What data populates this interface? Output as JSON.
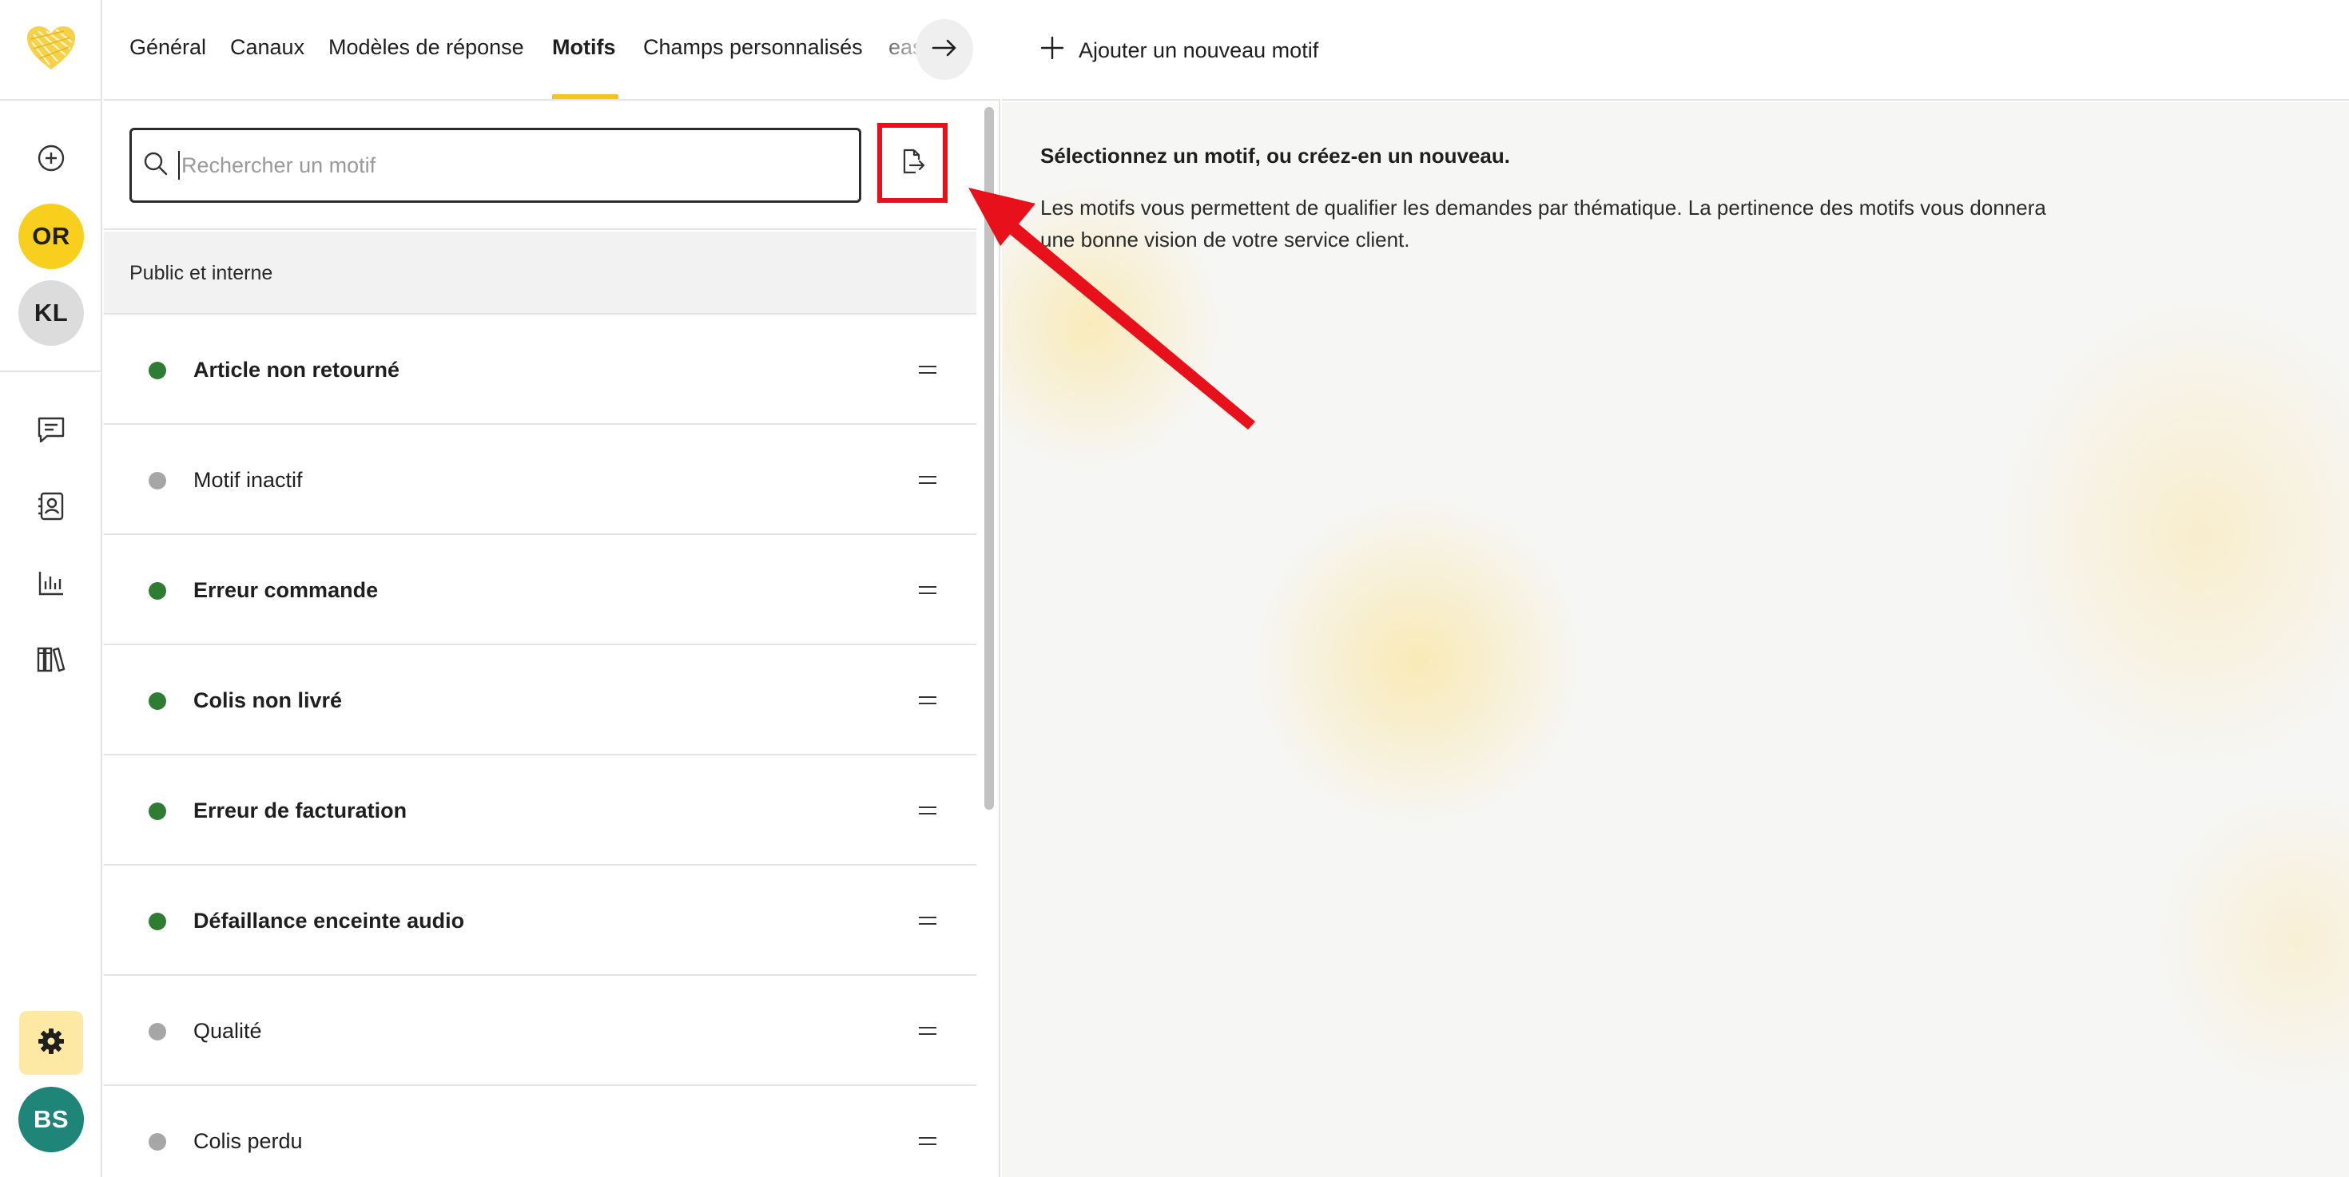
{
  "rail": {
    "logo_icon": "heart-logo",
    "add_icon": "plus-circle-icon",
    "avatars": [
      {
        "initials": "OR",
        "color": "#f9cf1d",
        "text_color": "#1f1f1f"
      },
      {
        "initials": "KL",
        "color": "#dcdcdc",
        "text_color": "#1f1f1f"
      }
    ],
    "nav_icons": [
      "chat-icon",
      "contacts-icon",
      "stats-icon",
      "library-icon"
    ],
    "settings_icon": "gear-icon",
    "user_avatar": {
      "initials": "BS",
      "color": "#1e8578",
      "text_color": "#ffffff"
    }
  },
  "tabs": {
    "items": [
      {
        "label": "Général",
        "active": false
      },
      {
        "label": "Canaux",
        "active": false
      },
      {
        "label": "Modèles de réponse",
        "active": false
      },
      {
        "label": "Motifs",
        "active": true
      },
      {
        "label": "Champs personnalisés",
        "active": false
      },
      {
        "label": "eas",
        "active": false
      }
    ],
    "next_icon": "arrow-right-icon",
    "accent_color": "#f5c518"
  },
  "search": {
    "placeholder": "Rechercher un motif",
    "value": "",
    "icon": "search-icon"
  },
  "export_button": {
    "icon": "file-export-icon",
    "highlight_color": "#e8101a"
  },
  "group": {
    "label": "Public et interne"
  },
  "motifs": [
    {
      "label": "Article non retourné",
      "active": true
    },
    {
      "label": "Motif inactif",
      "active": false
    },
    {
      "label": "Erreur commande",
      "active": true
    },
    {
      "label": "Colis non livré",
      "active": true
    },
    {
      "label": "Erreur de facturation",
      "active": true
    },
    {
      "label": "Défaillance enceinte audio",
      "active": true
    },
    {
      "label": "Qualité",
      "active": false
    },
    {
      "label": "Colis perdu",
      "active": false
    }
  ],
  "status_colors": {
    "active": "#2e7d32",
    "inactive": "#a6a6a6"
  },
  "right": {
    "add_label": "Ajouter un nouveau motif",
    "add_icon": "plus-icon",
    "title": "Sélectionnez un motif, ou créez-en un nouveau.",
    "description": "Les motifs vous permettent de qualifier les demandes par thématique. La pertinence des motifs vous donnera une bonne vision de votre service client."
  },
  "annotation": {
    "type": "arrow",
    "color": "#e8101a"
  }
}
